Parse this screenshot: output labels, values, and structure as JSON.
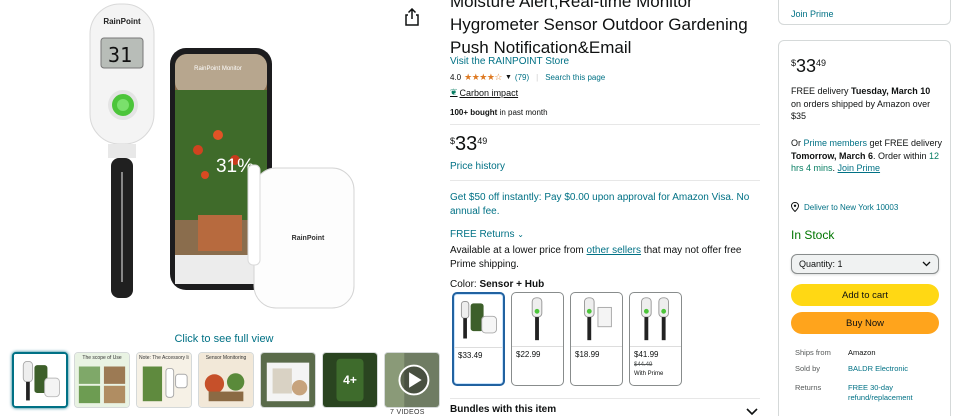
{
  "product": {
    "title": "Moisture Alert,Real-time Monitor Hygrometer Sensor Outdoor Gardening Push Notification&Email",
    "store_link": "Visit the RAINPOINT Store",
    "rating": "4.0",
    "stars": "★★★★☆",
    "review_count": "(79)",
    "search_page": "Search this page",
    "carbon_impact": "Carbon impact",
    "bought_bold": "100+ bought",
    "bought_rest": " in past month",
    "price": {
      "currency": "$",
      "whole": "33",
      "fraction": "49"
    },
    "price_history": "Price history",
    "promo": "Get $50 off instantly: Pay $0.00 upon approval for Amazon Visa. No annual fee.",
    "free_returns": "FREE Returns",
    "lower_price_pre": "Available at a lower price from ",
    "lower_price_link": "other sellers",
    "lower_price_post": " that may not offer free Prime shipping.",
    "color_label": "Color: ",
    "color_value": "Sensor + Hub",
    "swatches": [
      {
        "price": "$33.49",
        "list": "",
        "note": ""
      },
      {
        "price": "$22.99",
        "list": "",
        "note": ""
      },
      {
        "price": "$18.99",
        "list": "",
        "note": ""
      },
      {
        "price": "$41.99",
        "list": "$44.49",
        "note": "With Prime"
      }
    ],
    "bundles": "Bundles with this item"
  },
  "gallery": {
    "full_view": "Click to see full view",
    "brand": "RainPoint",
    "lcd_value": "31",
    "phone_value": "31%",
    "phone_title": "RainPoint Monitor",
    "thumb_captions": [
      "",
      "The scope of Use",
      "Note: The Accessory list",
      "Sensor Monitoring",
      "",
      "",
      ""
    ],
    "more_label": "4+",
    "videos_label": "7 VIDEOS"
  },
  "buybox": {
    "join_prime_top": "Join Prime",
    "price": {
      "currency": "$",
      "whole": "33",
      "fraction": "49"
    },
    "delivery_pre": "FREE delivery ",
    "delivery_date": "Tuesday, March 10",
    "delivery_post": " on orders shipped by Amazon over $35",
    "prime_pre": "Or ",
    "prime_link": "Prime members",
    "prime_mid": " get FREE delivery ",
    "prime_date": "Tomorrow, March 6",
    "prime_order": ". Order within ",
    "prime_time": "12 hrs 4 mins",
    "prime_join": "Join Prime",
    "deliver_to": "Deliver to New York 10003",
    "in_stock": "In Stock",
    "quantity": "Quantity: 1",
    "add_to_cart": "Add to cart",
    "buy_now": "Buy Now",
    "ships_from_k": "Ships from",
    "ships_from_v": "Amazon",
    "sold_by_k": "Sold by",
    "sold_by_v": "BALDR Electronic",
    "returns_k": "Returns",
    "returns_v": "FREE 30-day refund/replacement"
  },
  "colors": {
    "link": "#007185",
    "add_to_cart": "#FFD814",
    "buy_now": "#FFA41C",
    "in_stock": "#007600",
    "stars": "#DE7921",
    "sensor_green": "#4CC53A"
  }
}
